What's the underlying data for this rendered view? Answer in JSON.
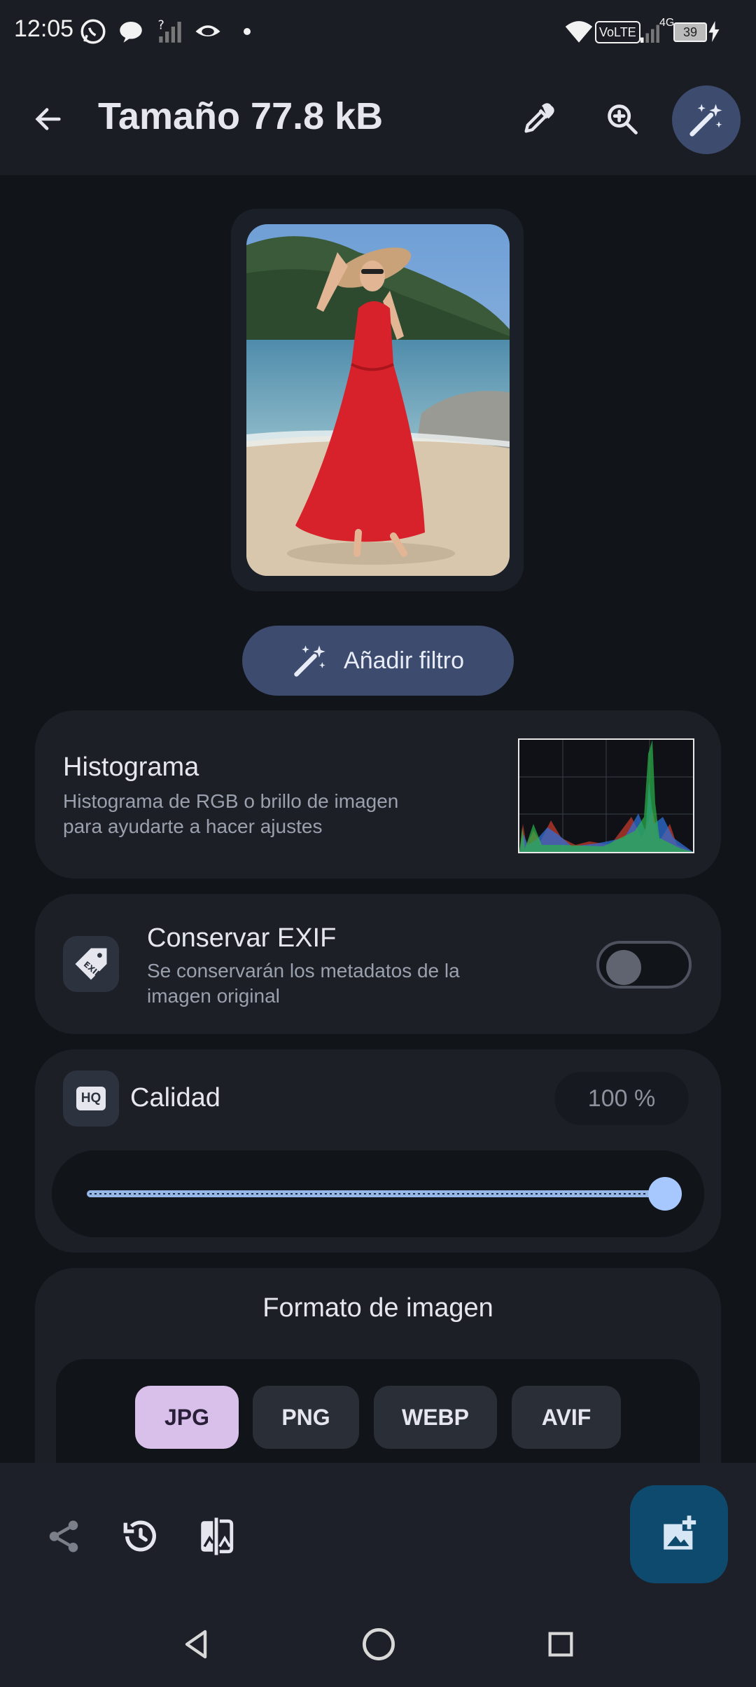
{
  "status_bar": {
    "time": "12:05",
    "battery": "39",
    "network": "4G",
    "volte": "VoLTE"
  },
  "app_bar": {
    "title": "Tamaño 77.8 kB"
  },
  "add_filter": {
    "label": "Añadir filtro"
  },
  "histogram_card": {
    "title": "Histograma",
    "subtitle_line1": "Histograma de RGB o brillo de imagen",
    "subtitle_line2": "para ayudarte a hacer ajustes"
  },
  "exif_card": {
    "title": "Conservar EXIF",
    "subtitle_line1": "Se conservarán los metadatos de la",
    "subtitle_line2": "imagen original",
    "icon_text": "EXIF",
    "enabled": false
  },
  "quality_card": {
    "title": "Calidad",
    "value": "100 %",
    "icon_text": "HQ",
    "slider_fraction": 1.0
  },
  "format_card": {
    "title": "Formato de imagen",
    "formats": [
      "JPG",
      "PNG",
      "WEBP",
      "AVIF"
    ],
    "selected": "JPG"
  },
  "colors": {
    "background": "#111419",
    "card": "#1c1f26",
    "accent": "#a6c8ff",
    "filter_button": "#3c4b6e",
    "chip_selected": "#d9c0ea",
    "fab": "#0d4a6e"
  }
}
